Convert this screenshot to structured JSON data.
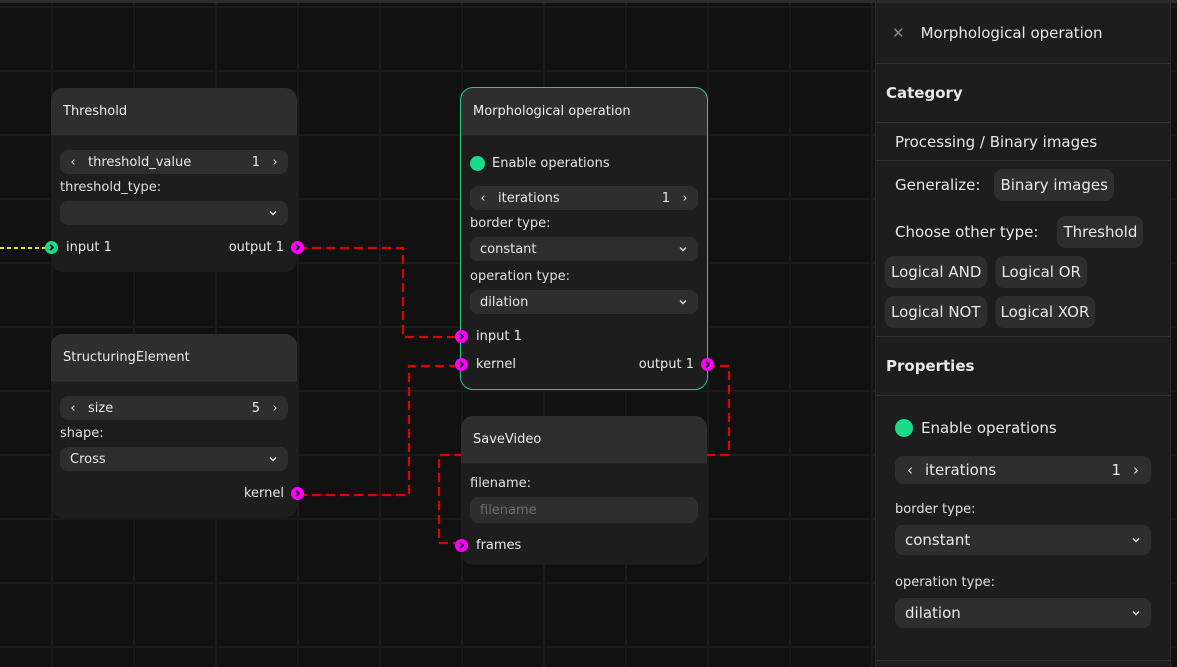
{
  "canvas": {
    "nodes": {
      "threshold": {
        "title": "Threshold",
        "stepper": {
          "label": "threshold_value",
          "value": "1"
        },
        "type_label": "threshold_type:",
        "type_value": "",
        "input_label": "input 1",
        "output_label": "output 1"
      },
      "structuring": {
        "title": "StructuringElement",
        "stepper": {
          "label": "size",
          "value": "5"
        },
        "shape_label": "shape:",
        "shape_value": "Cross",
        "output_label": "kernel"
      },
      "morph": {
        "title": "Morphological operation",
        "toggle_label": "Enable operations",
        "stepper": {
          "label": "iterations",
          "value": "1"
        },
        "border_label": "border type:",
        "border_value": "constant",
        "op_label": "operation type:",
        "op_value": "dilation",
        "input1_label": "input 1",
        "kernel_label": "kernel",
        "output_label": "output 1"
      },
      "savevideo": {
        "title": "SaveVideo",
        "filename_label": "filename:",
        "filename_value": "",
        "filename_placeholder": "filename",
        "frames_label": "frames"
      }
    },
    "colors": {
      "wire": "#e00000",
      "incoming_wire": "#e8e800",
      "port_image": "#ff00ff",
      "port_input": "#18dc8a",
      "selected_border": "#28c88a",
      "toggle_on": "#18dc8a"
    }
  },
  "panel": {
    "title": "Morphological operation",
    "category_heading": "Category",
    "category_path": "Processing / Binary images",
    "generalize_label": "Generalize:",
    "generalize_chip": "Binary images",
    "other_type_label": "Choose other type:",
    "other_types": [
      "Threshold",
      "Logical AND",
      "Logical OR",
      "Logical NOT",
      "Logical XOR"
    ],
    "properties_heading": "Properties",
    "props": {
      "toggle_label": "Enable operations",
      "stepper": {
        "label": "iterations",
        "value": "1"
      },
      "border_label": "border type:",
      "border_value": "constant",
      "op_label": "operation type:",
      "op_value": "dilation"
    }
  }
}
